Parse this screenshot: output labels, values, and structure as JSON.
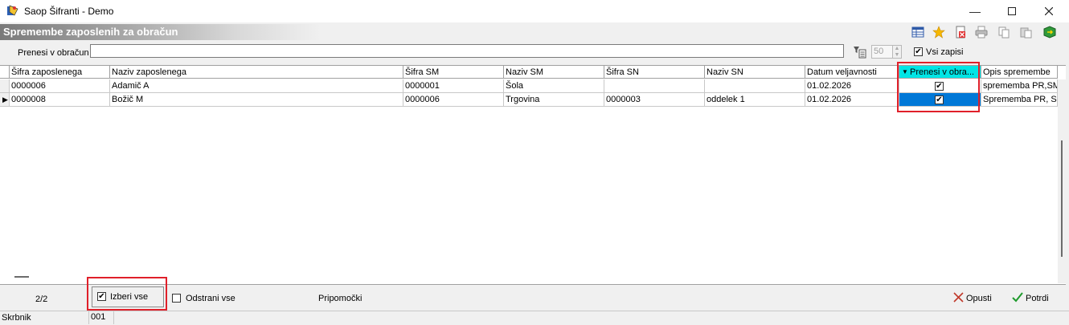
{
  "window": {
    "title": "Saop Šifranti - Demo",
    "controls": [
      "minimize-icon",
      "maximize-icon",
      "close-icon"
    ]
  },
  "header": {
    "title": "Spremembe zaposlenih za obračun",
    "toolbar_icons": [
      "table-settings-icon",
      "favorite-star-icon",
      "delete-icon",
      "print-icon",
      "copy-icon",
      "paste-icon",
      "exit-icon"
    ]
  },
  "filter": {
    "label": "Prenesi v obračun",
    "value": "",
    "count": "50",
    "all_records_label": "Vsi zapisi",
    "all_records_checked": true
  },
  "grid": {
    "columns": [
      "Šifra zaposlenega",
      "Naziv zaposlenega",
      "Šifra SM",
      "Naziv SM",
      "Šifra SN",
      "Naziv SN",
      "Datum veljavnosti",
      "Prenesi v obra...",
      "Opis spremembe"
    ],
    "rows": [
      {
        "sifra_zap": "0000006",
        "naziv_zap": "Adamič A",
        "sifra_sm": "0000001",
        "naziv_sm": "Šola",
        "sifra_sn": "",
        "naziv_sn": "",
        "datum": "01.02.2026",
        "prenesi": true,
        "opis": "sprememba PR,SM"
      },
      {
        "sifra_zap": "0000008",
        "naziv_zap": "Božič M",
        "sifra_sm": "0000006",
        "naziv_sm": "Trgovina",
        "sifra_sn": "0000003",
        "naziv_sn": "oddelek 1",
        "datum": "01.02.2026",
        "prenesi": true,
        "opis": "Sprememba PR, S"
      }
    ],
    "sorted_column_color": "#00e5e5",
    "selected_cell_color": "#0078d7"
  },
  "footer": {
    "row_count": "2/2",
    "select_all_label": "Izberi vse",
    "select_all_checked": true,
    "remove_all_label": "Odstrani vse",
    "remove_all_checked": false,
    "tools_label": "Pripomočki",
    "cancel_label": "Opusti",
    "confirm_label": "Potrdi"
  },
  "status": {
    "label": "Skrbnik",
    "value": "001"
  },
  "highlight_color": "#e0202a"
}
